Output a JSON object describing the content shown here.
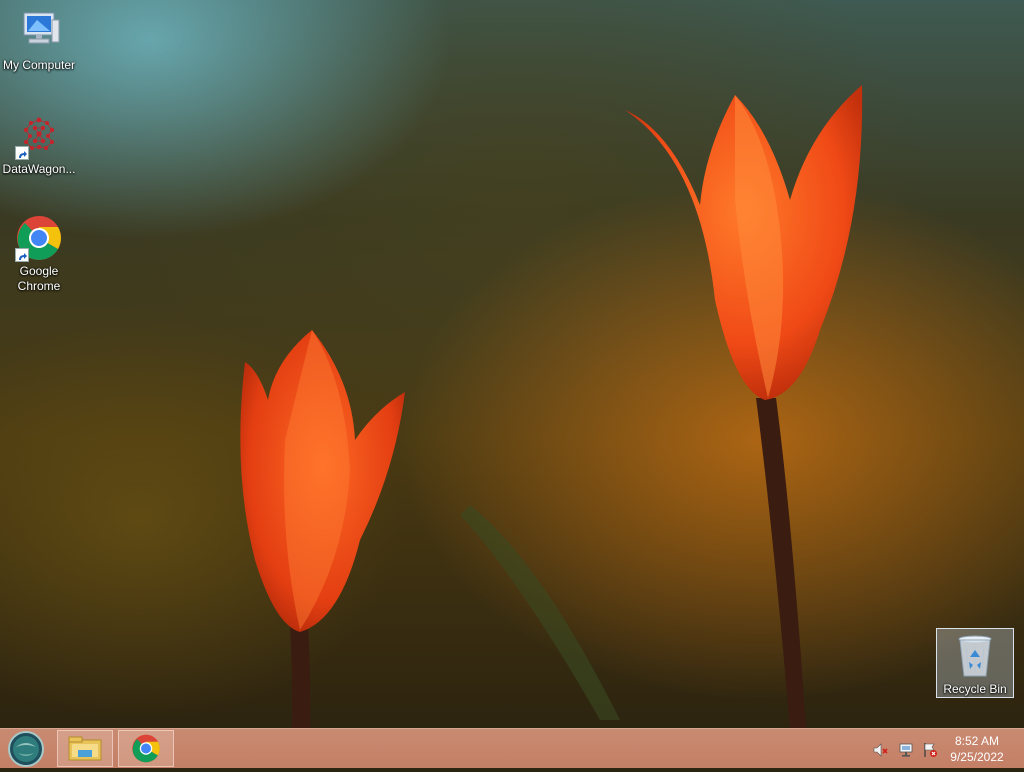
{
  "desktop": {
    "icons": [
      {
        "label": "My Computer",
        "icon": "computer-icon"
      },
      {
        "label": "DataWagon...",
        "icon": "datawagon-icon"
      },
      {
        "label": "Google Chrome",
        "icon": "chrome-icon"
      }
    ],
    "recycle_bin": {
      "label": "Recycle Bin",
      "icon": "recycle-bin-icon"
    }
  },
  "taskbar": {
    "start": {
      "icon": "start-orb-icon"
    },
    "buttons": [
      {
        "icon": "file-explorer-icon"
      },
      {
        "icon": "chrome-icon"
      }
    ],
    "tray": {
      "icons": [
        "volume-muted-icon",
        "network-icon",
        "action-center-icon"
      ],
      "time": "8:52 AM",
      "date": "9/25/2022"
    }
  },
  "colors": {
    "taskbar": "#c47f66",
    "tulip": "#ff5a1e",
    "chrome_red": "#db4437",
    "chrome_yellow": "#f4c20d",
    "chrome_green": "#0f9d58",
    "chrome_blue": "#4285f4"
  }
}
